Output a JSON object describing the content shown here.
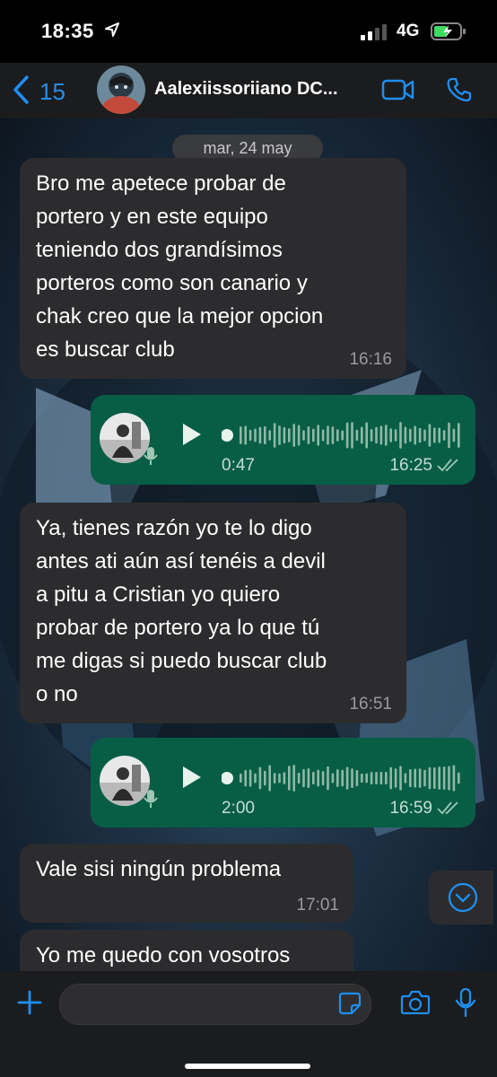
{
  "status_bar": {
    "time": "18:35",
    "network": "4G",
    "location_icon": "location-arrow-icon",
    "signal_icon": "signal-bars-icon",
    "battery_icon": "battery-charging-icon"
  },
  "header": {
    "back_count": "15",
    "contact_name": "Aalexiissoriiano DC...",
    "back_icon": "chevron-left-icon",
    "video_icon": "video-camera-icon",
    "call_icon": "phone-icon"
  },
  "chat": {
    "date_label": "mar, 24 may",
    "messages": [
      {
        "dir": "in",
        "text": "Bro me apetece probar de\nportero y en este equipo\nteniendo dos grandísimos\nporteros como son canario y\nchak creo que la mejor opcion\nes buscar club",
        "time": "16:16"
      },
      {
        "dir": "out",
        "type": "voice",
        "duration": "0:47",
        "time": "16:25"
      },
      {
        "dir": "in",
        "text": "Ya, tienes razón yo te lo digo\nantes ati aún así tenéis a devil\na pitu a Cristian yo quiero\nprobar de portero ya lo que tú\nme digas si puedo buscar club\no no",
        "time": "16:51"
      },
      {
        "dir": "out",
        "type": "voice",
        "duration": "2:00",
        "time": "16:59"
      },
      {
        "dir": "in",
        "text": "Vale sisi ningún problema",
        "time": "17:01"
      },
      {
        "dir": "in",
        "text": "Yo me quedo con vosotros",
        "time": ""
      }
    ]
  },
  "input_bar": {
    "plus_icon": "plus-icon",
    "sticker_icon": "sticker-icon",
    "camera_icon": "camera-icon",
    "mic_icon": "microphone-icon"
  },
  "colors": {
    "accent": "#1f8ff0",
    "incoming_bubble": "#2c2c2e",
    "outgoing_bubble": "#075e45",
    "header_bg": "#1b1c1e"
  }
}
